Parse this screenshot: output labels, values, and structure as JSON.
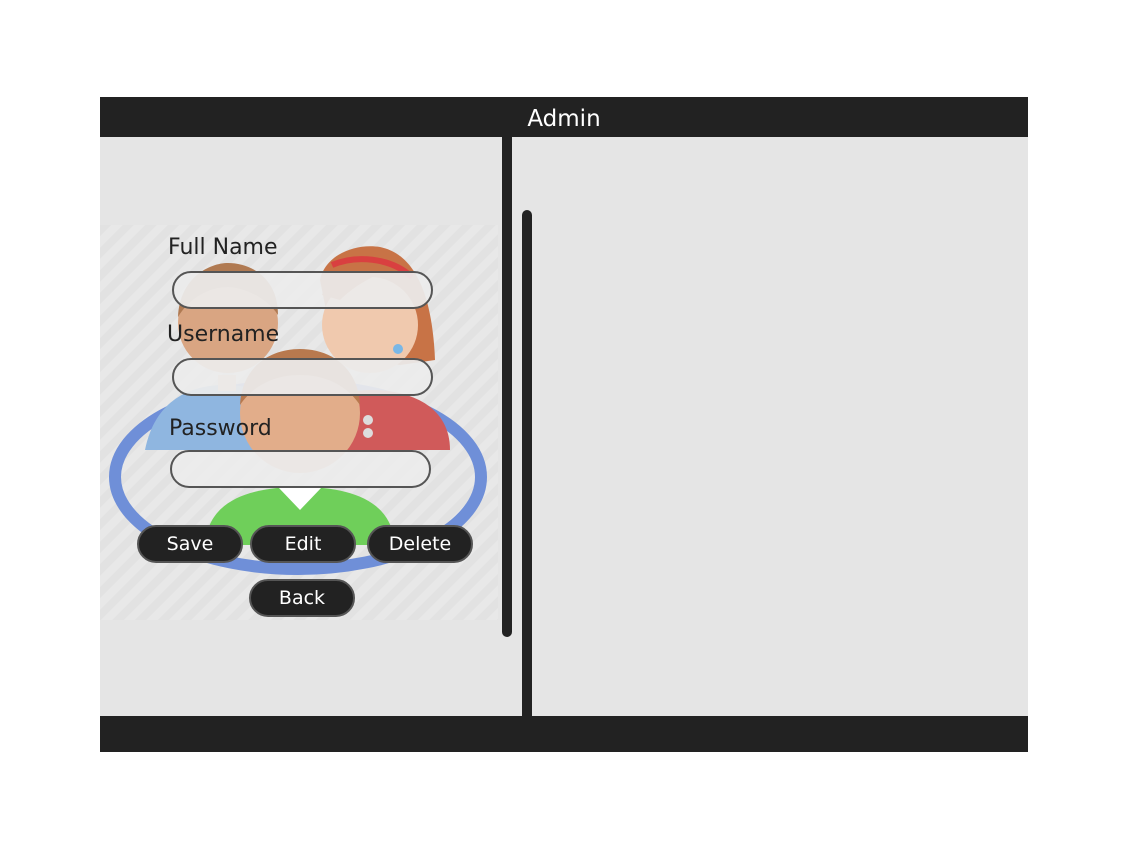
{
  "window": {
    "title": "Admin"
  },
  "form": {
    "fields": [
      {
        "label": "Full Name",
        "value": "",
        "placeholder": ""
      },
      {
        "label": "Username",
        "value": "",
        "placeholder": ""
      },
      {
        "label": "Password",
        "value": "",
        "placeholder": ""
      }
    ],
    "buttons": {
      "save": "Save",
      "edit": "Edit",
      "delete": "Delete",
      "back": "Back"
    },
    "illustration_icon": "users-group-icon"
  },
  "colors": {
    "bar": "#222222",
    "panel_bg": "#e5e5e5",
    "ring": "#6f8fd8",
    "shirt_blue": "#8fb6e0",
    "shirt_red": "#d05a5a",
    "shirt_green": "#6fcf5a"
  }
}
